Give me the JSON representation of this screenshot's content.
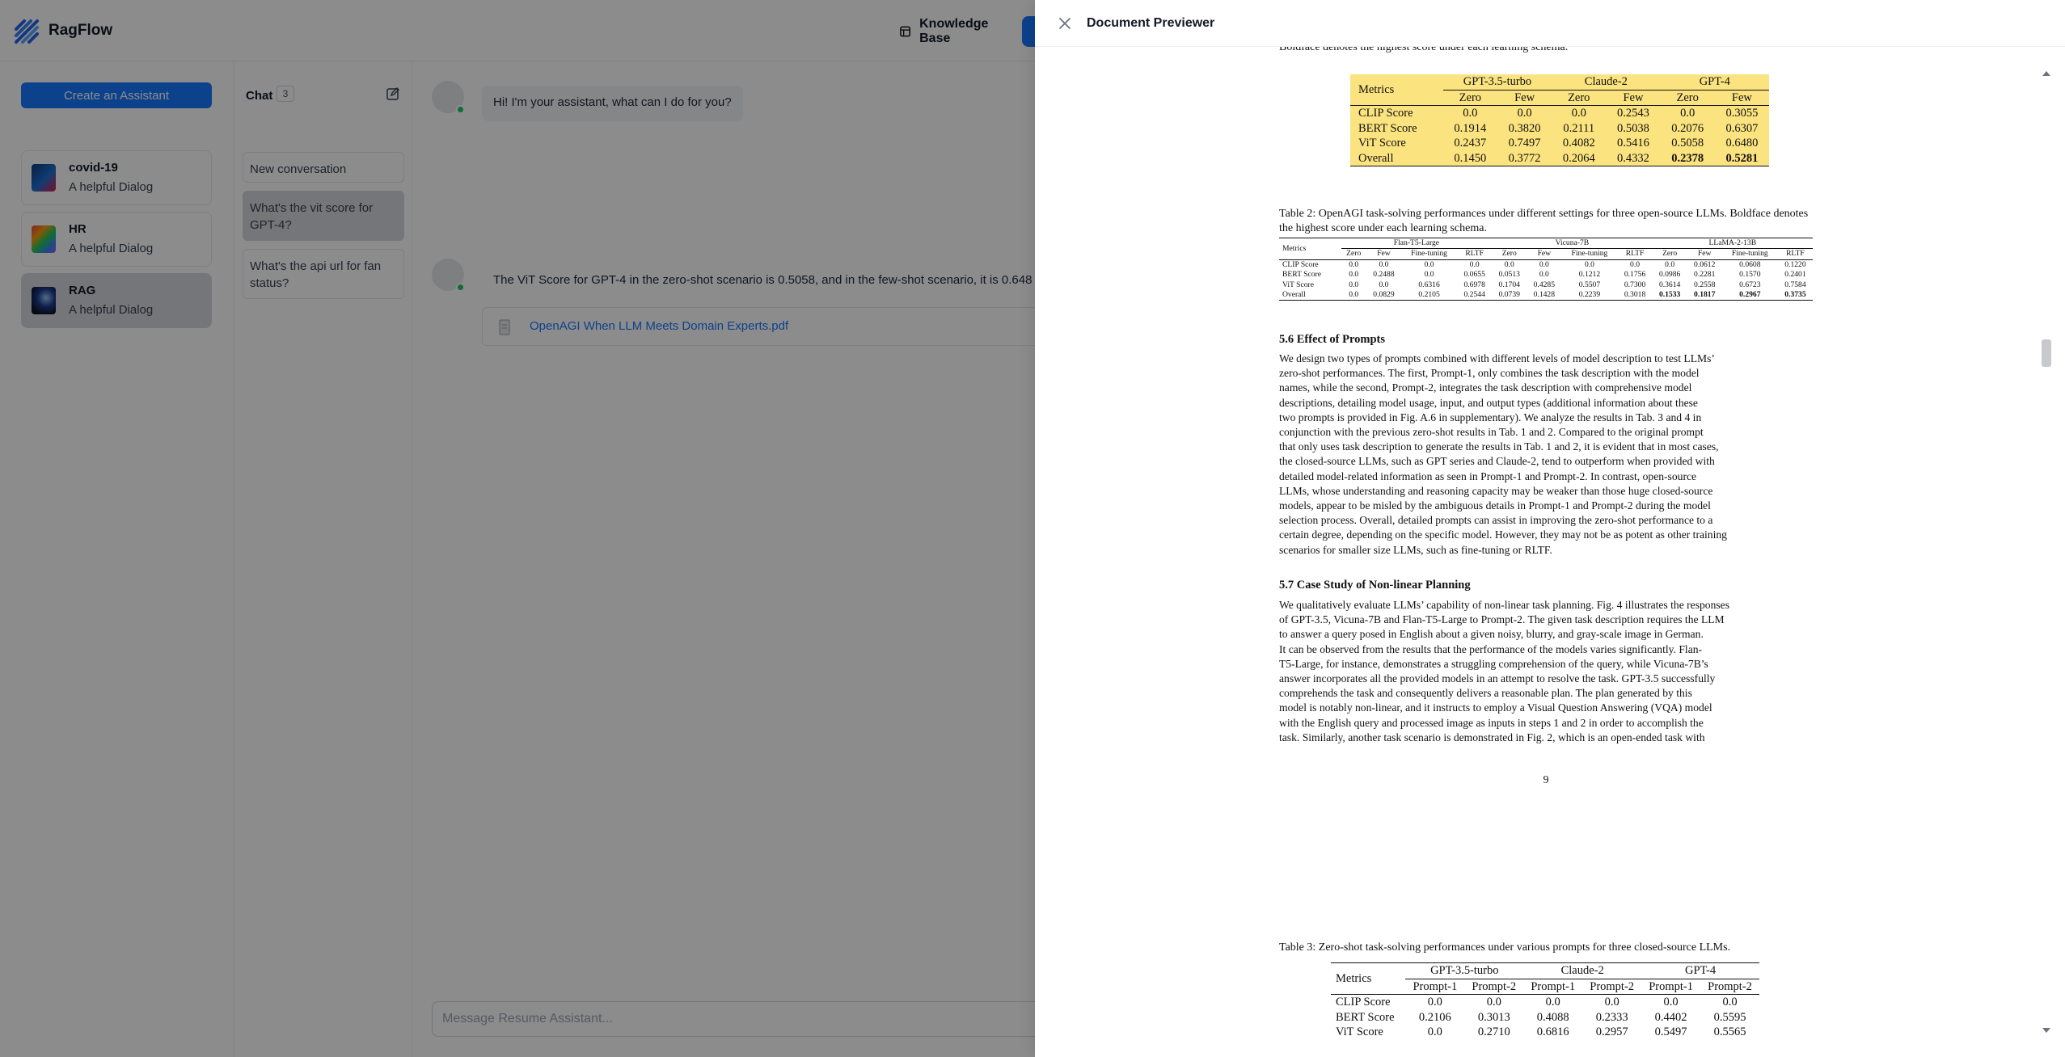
{
  "app": {
    "brand": "RagFlow",
    "knowledge_base": "Knowledge Base",
    "create_assistant": "Create an Assistant"
  },
  "assistants": [
    {
      "name": "covid-19",
      "desc": "A helpful Dialog"
    },
    {
      "name": "HR",
      "desc": "A helpful Dialog"
    },
    {
      "name": "RAG",
      "desc": "A helpful Dialog"
    }
  ],
  "chat": {
    "title": "Chat",
    "count": "3",
    "conversations": [
      "New conversation",
      "What's the vit score for GPT-4?",
      "What's the api url for fan status?"
    ],
    "greeting": "Hi! I'm your assistant, what can I do for you?",
    "answer": "The ViT Score for GPT-4 in the zero-shot scenario is 0.5058, and in the few-shot scenario, it is 0.648",
    "ref_file": "OpenAGI When LLM Meets Domain Experts.pdf",
    "input_placeholder": "Message Resume Assistant..."
  },
  "drawer": {
    "title": "Document Previewer"
  },
  "pdf": {
    "t1_caption": "Boldface denotes the highest score under each learning schema.",
    "t1": {
      "metrics": "Metrics",
      "groups": [
        "GPT-3.5-turbo",
        "Claude-2",
        "GPT-4"
      ],
      "sub": [
        "Zero",
        "Few",
        "Zero",
        "Few",
        "Zero",
        "Few"
      ],
      "rows": [
        {
          "label": "CLIP Score",
          "vals": [
            "0.0",
            "0.0",
            "0.0",
            "0.2543",
            "0.0",
            "0.3055"
          ]
        },
        {
          "label": "BERT Score",
          "vals": [
            "0.1914",
            "0.3820",
            "0.2111",
            "0.5038",
            "0.2076",
            "0.6307"
          ]
        },
        {
          "label": "ViT Score",
          "vals": [
            "0.2437",
            "0.7497",
            "0.4082",
            "0.5416",
            "0.5058",
            "0.6480"
          ]
        },
        {
          "label": "Overall",
          "vals": [
            "0.1450",
            "0.3772",
            "0.2064",
            "0.4332",
            "0.2378",
            "0.5281"
          ]
        }
      ]
    },
    "t2_caption": "Table 2: OpenAGI task-solving performances under different settings for three open-source LLMs. Boldface denotes the highest score under each learning schema.",
    "t2": {
      "metrics": "Metrics",
      "groups": [
        "Flan-T5-Large",
        "Vicuna-7B",
        "LLaMA-2-13B"
      ],
      "sub": [
        "Zero",
        "Few",
        "Fine-tuning",
        "RLTF",
        "Zero",
        "Few",
        "Fine-tuning",
        "RLTF",
        "Zero",
        "Few",
        "Fine-tuning",
        "RLTF"
      ],
      "rows": [
        {
          "label": "CLIP Score",
          "vals": [
            "0.0",
            "0.0",
            "0.0",
            "0.0",
            "0.0",
            "0.0",
            "0.0",
            "0.0",
            "0.0",
            "0.0612",
            "0.0608",
            "0.1220"
          ]
        },
        {
          "label": "BERT Score",
          "vals": [
            "0.0",
            "0.2488",
            "0.0",
            "0.0655",
            "0.0513",
            "0.0",
            "0.1212",
            "0.1756",
            "0.0986",
            "0.2281",
            "0.1570",
            "0.2401"
          ]
        },
        {
          "label": "ViT Score",
          "vals": [
            "0.0",
            "0.0",
            "0.6316",
            "0.6978",
            "0.1704",
            "0.4285",
            "0.5507",
            "0.7300",
            "0.3614",
            "0.2558",
            "0.6723",
            "0.7584"
          ]
        },
        {
          "label": "Overall",
          "vals": [
            "0.0",
            "0.0829",
            "0.2105",
            "0.2544",
            "0.0739",
            "0.1428",
            "0.2239",
            "0.3018",
            "0.1533",
            "0.1817",
            "0.2967",
            "0.3735"
          ]
        }
      ]
    },
    "s56_title": "5.6    Effect of Prompts",
    "s56_lines": [
      "We design two types of prompts combined with different levels of model description to test LLMs’",
      "zero-shot performances. The first, Prompt-1, only combines the task description with the model",
      "names, while the second, Prompt-2, integrates the task description with comprehensive model",
      "descriptions, detailing model usage, input, and output types (additional information about these",
      "two prompts is provided in Fig. A.6 in supplementary). We analyze the results in Tab. 3 and 4 in",
      "conjunction with the previous zero-shot results in Tab. 1 and 2. Compared to the original prompt",
      "that only uses task description to generate the results in Tab. 1 and 2, it is evident that in most cases,",
      "the closed-source LLMs, such as GPT series and Claude-2, tend to outperform when provided with",
      "detailed model-related information as seen in Prompt-1 and Prompt-2. In contrast, open-source",
      "LLMs, whose understanding and reasoning capacity may be weaker than those huge closed-source",
      "models, appear to be misled by the ambiguous details in Prompt-1 and Prompt-2 during the model",
      "selection process. Overall, detailed prompts can assist in improving the zero-shot performance to a",
      "certain degree, depending on the specific model. However, they may not be as potent as other training",
      "scenarios for smaller size LLMs, such as fine-tuning or RLTF."
    ],
    "s57_title": "5.7    Case Study of Non-linear Planning",
    "s57_lines": [
      "We qualitatively evaluate LLMs’ capability of non-linear task planning. Fig. 4 illustrates the responses",
      "of GPT-3.5, Vicuna-7B and Flan-T5-Large to Prompt-2. The given task description requires the LLM",
      "to answer a query posed in English about a given noisy, blurry, and gray-scale image in German.",
      "It can be observed from the results that the performance of the models varies significantly. Flan-",
      "T5-Large, for instance, demonstrates a struggling comprehension of the query, while Vicuna-7B’s",
      "answer incorporates all the provided models in an attempt to resolve the task. GPT-3.5 successfully",
      "comprehends the task and consequently delivers a reasonable plan. The plan generated by this",
      "model is notably non-linear, and it instructs to employ a Visual Question Answering (VQA) model",
      "with the English query and processed image as inputs in steps 1 and 2 in order to accomplish the",
      "task. Similarly, another task scenario is demonstrated in Fig. 2, which is an open-ended task with"
    ],
    "page_number": "9",
    "t3_caption": "Table 3: Zero-shot task-solving performances under various prompts for three closed-source LLMs.",
    "t3": {
      "metrics": "Metrics",
      "groups": [
        "GPT-3.5-turbo",
        "Claude-2",
        "GPT-4"
      ],
      "sub": [
        "Prompt-1",
        "Prompt-2",
        "Prompt-1",
        "Prompt-2",
        "Prompt-1",
        "Prompt-2"
      ],
      "rows": [
        {
          "label": "CLIP Score",
          "vals": [
            "0.0",
            "0.0",
            "0.0",
            "0.0",
            "0.0",
            "0.0"
          ]
        },
        {
          "label": "BERT Score",
          "vals": [
            "0.2106",
            "0.3013",
            "0.4088",
            "0.2333",
            "0.4402",
            "0.5595"
          ]
        },
        {
          "label": "ViT Score",
          "vals": [
            "0.0",
            "0.2710",
            "0.6816",
            "0.2957",
            "0.5497",
            "0.5565"
          ]
        }
      ]
    }
  }
}
